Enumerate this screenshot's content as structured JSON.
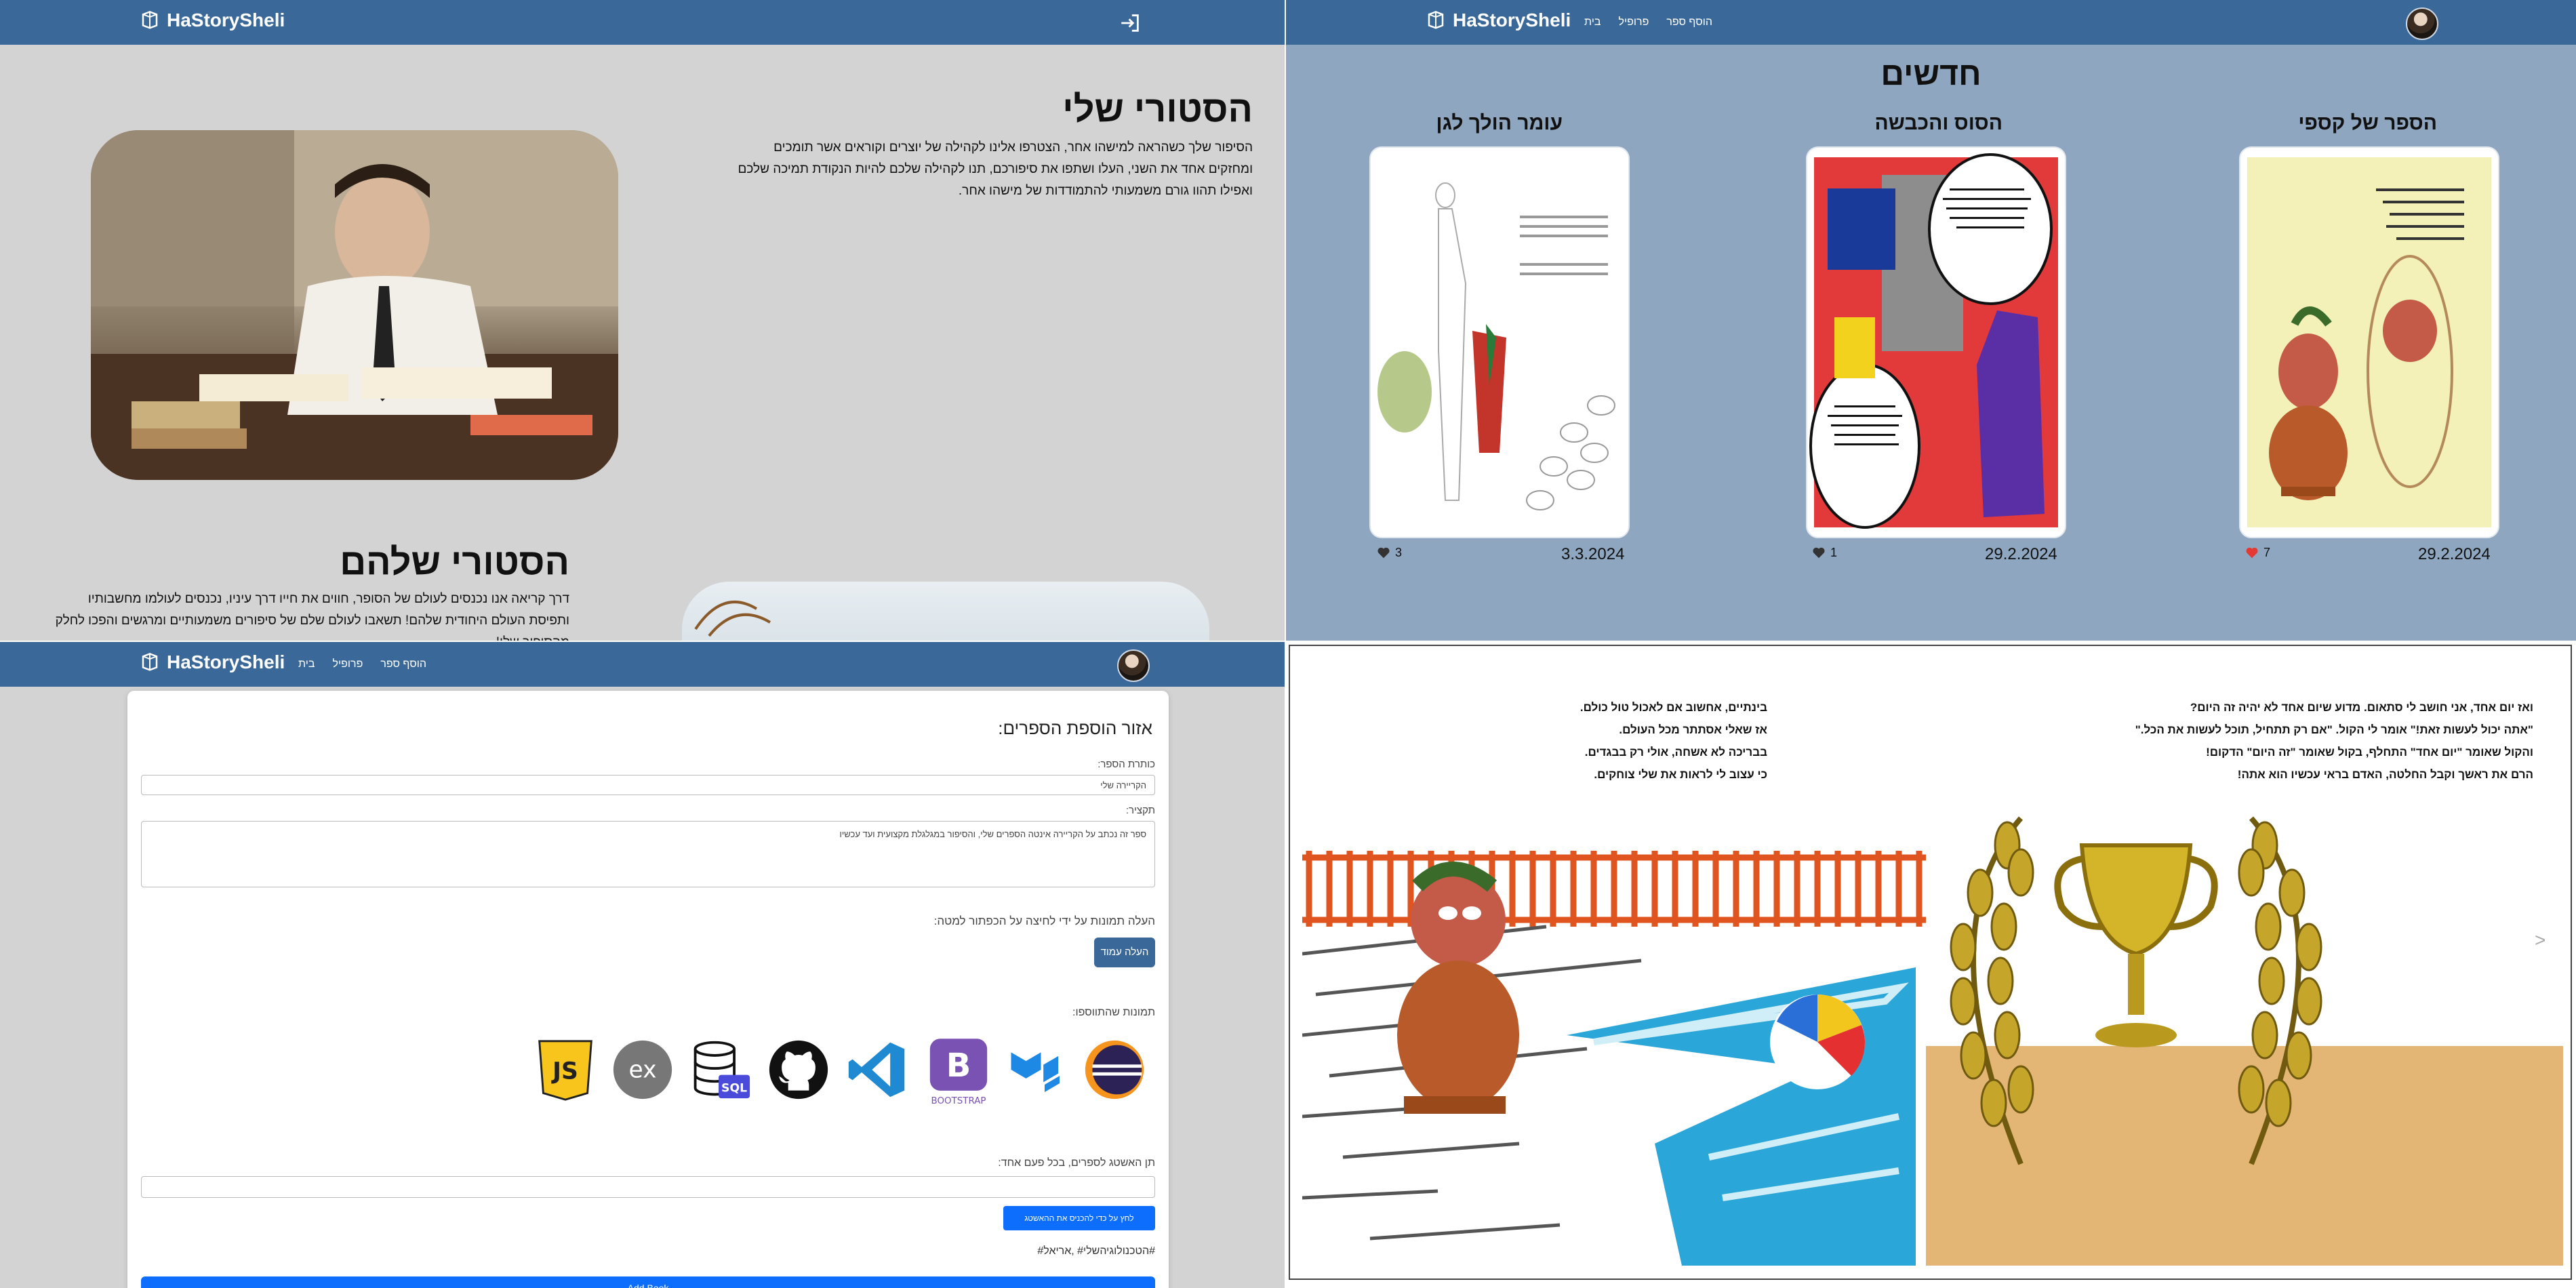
{
  "brand": "HaStorySheli",
  "nav": {
    "book": "הוסף ספר",
    "profile": "פרופיל",
    "home": "בית"
  },
  "landing": {
    "my_title": "הסטורי שלי",
    "my_text_1": "הסיפור שלך כשהראה למישהו אחר, הצטרפו אלינו לקהילה של יוצרים וקוראים אשר תומכים",
    "my_text_2": "ומחזקים אחד את השני, העלו ושתפו את סיפורכם, תנו לקהילה שלכם להיות הנקודת תמיכה שלכם",
    "my_text_3": "ואפילו תהוו גורם משמעותי להתמודדות של מישהו אחר.",
    "their_title": "הסטורי שלהם",
    "their_text_1": "דרך קריאה אנו נכנסים לעולם של הסופר, חווים את חייו דרך עיניו, נכנסים לעולמו מחשבותיו",
    "their_text_2": "ותפיסת העולם היחודית שלהם! תשאבו לעולם שלם של סיפורים משמעותיים ומרגשים והפכו לחלק",
    "their_text_3": "מהסיפור שלו!"
  },
  "news": {
    "title": "חדשים",
    "cards": [
      {
        "title": "הספר של קספי",
        "date": "29.2.2024",
        "likes": "7",
        "liked": true
      },
      {
        "title": "הסוס והכבשה",
        "date": "29.2.2024",
        "likes": "1",
        "liked": false
      },
      {
        "title": "עומר הולך לגן",
        "date": "3.3.2024",
        "likes": "3",
        "liked": false
      }
    ],
    "liked_color": "#e53935"
  },
  "form": {
    "heading": "אזור הוספת הספרים:",
    "book_title_label": "כותרת הספר:",
    "book_title_value": "הקריירה שלי",
    "summary_label": "תקציר:",
    "summary_value": "ספר זה נכתב על הקריירה אינטה הספרים שלי, והסיפור במגלגלת מקצועית ועד עכשיו",
    "upload_label": "העלה תמונות על ידי לחיצה על הכפתור למטה:",
    "upload_button": "העלה עמוד",
    "images_label": "תמונות שהתווספו:",
    "tags_label": "תן האשטג לספרים, בכל פעם אחד:",
    "tags_button": "לחץ על כדי להכניס את ההאשטג",
    "tags_list": "#הטכנולוגיהשלי# ,אריאל#",
    "add_button": "Add Book",
    "add_color": "#0d6efd"
  },
  "tech_icons": [
    "javascript-icon",
    "express-icon",
    "sql-icon",
    "github-icon",
    "vscode-icon",
    "bootstrap-icon",
    "mui-icon",
    "eclipse-icon"
  ],
  "bootstrap_label": "BOOTSTRAP",
  "sql_label": "SQL",
  "ex_label": "ex",
  "js_label": "JS",
  "reader": {
    "right_lines": [
      "ואז יום אחד, אני חושב לי סתאום. מדוע שיום אחד לא יהיה זה היום?",
      "\"אתה יכול לעשות זאת!\" אומר לי הקול. \"אם רק תתחיל, תוכל לעשות את הכל.\"",
      "והקול שאומר \"יום אחד\" התחלף, בקול שאומר \"זה היום\" הדקום!",
      "הרם את ראשך וקבל החלטה, האדם בראי עכשיו הוא אתה!"
    ],
    "left_lines": [
      "בינתיים, אחשוב אם לאכול טול כולם.",
      "אז שאלי אסתתר מכל העולם.",
      "בבריכה לא אשחה, אולי רק בבגדים.",
      "כי עצוב לי לראות את שלי צוחקים."
    ],
    "next_arrow": ">"
  }
}
